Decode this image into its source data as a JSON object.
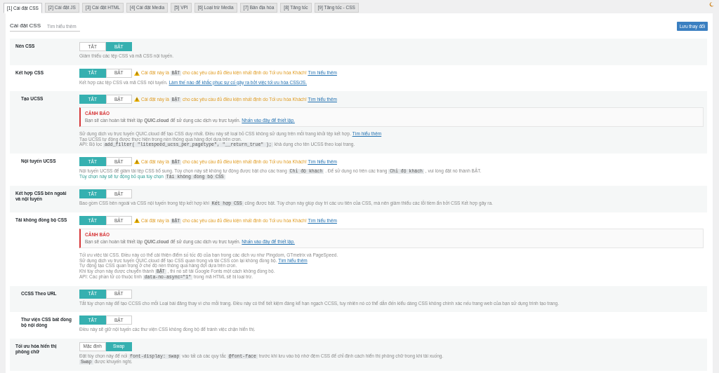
{
  "tabs": [
    {
      "label": "[1] Cài đặt CSS",
      "selected": true
    },
    {
      "label": "[2] Cài đặt JS",
      "selected": false
    },
    {
      "label": "[3] Cài đặt HTML",
      "selected": false
    },
    {
      "label": "[4] Cài đặt Media",
      "selected": false
    },
    {
      "label": "[5] VPI",
      "selected": false
    },
    {
      "label": "[6] Loại trừ Media",
      "selected": false
    },
    {
      "label": "[7] Bản địa hóa",
      "selected": false
    },
    {
      "label": "[8] Tăng tốc",
      "selected": false
    },
    {
      "label": "[9] Tăng tốc - CSS",
      "selected": false
    }
  ],
  "header": {
    "title": "Cài đặt CSS",
    "link": "Tìm hiểu thêm",
    "save_button": "Lưu thay đổi"
  },
  "settings": [
    {
      "label": "Nén CSS",
      "toggle": [
        {
          "label": "TẮT",
          "selected": false
        },
        {
          "label": "BẬT",
          "selected": true
        }
      ],
      "description": [
        {
          "kind": "plain",
          "parts": [
            {
              "kind": "text",
              "text": "Giảm thiểu các tệp CSS và mã CSS nội tuyến."
            }
          ]
        }
      ]
    },
    {
      "label": "Kết hợp CSS",
      "toggle": [
        {
          "label": "TẮT",
          "selected": true
        },
        {
          "label": "BẬT",
          "selected": false
        }
      ],
      "warning": {
        "parts": [
          {
            "kind": "text",
            "text": "Cài đặt này là"
          },
          {
            "kind": "code",
            "text": "BẬT"
          },
          {
            "kind": "text",
            "text": "cho các yêu cầu đủ điều kiện nhất định do Tối ưu hóa Khách!"
          },
          {
            "kind": "link",
            "text": "Tìm hiểu thêm"
          }
        ]
      },
      "description": [
        {
          "kind": "plain",
          "parts": [
            {
              "kind": "text",
              "text": "Kết hợp các tệp CSS và mã CSS nội tuyến."
            },
            {
              "kind": "link",
              "text": "Làm thế nào để khắc phục sự cố gây ra bởi việc tối ưu hóa CSS/JS."
            }
          ]
        }
      ],
      "children": [
        {
          "label": "Tạo UCSS",
          "toggle": [
            {
              "label": "TẮT",
              "selected": true
            },
            {
              "label": "BẬT",
              "selected": false
            }
          ],
          "warning": {
            "parts": [
              {
                "kind": "text",
                "text": "Cài đặt này là"
              },
              {
                "kind": "code",
                "text": "BẬT"
              },
              {
                "kind": "text",
                "text": "cho các yêu cầu đủ điều kiện nhất định do Tối ưu hóa Khách!"
              },
              {
                "kind": "link",
                "text": "Tìm hiểu thêm"
              }
            ]
          },
          "notice": {
            "title": "CẢNH BÁO",
            "parts": [
              {
                "kind": "text",
                "text": "Bạn sẽ cần hoàn tất thiết lập **QUIC.cloud** để sử dụng các dịch vụ trực tuyến."
              },
              {
                "kind": "link",
                "text": "Nhấn vào đây để thiết lập."
              }
            ]
          },
          "description": [
            {
              "kind": "plain",
              "parts": [
                {
                  "kind": "text",
                  "text": "Sử dụng dịch vụ trực tuyến QUIC.cloud để tạo CSS duy nhất. Điều này sẽ loại bỏ CSS không sử dụng trên mỗi trang khỏi tệp kết hợp."
                },
                {
                  "kind": "link",
                  "text": "Tìm hiểu thêm"
                }
              ]
            },
            {
              "kind": "plain",
              "parts": [
                {
                  "kind": "text",
                  "text": "Tạo UCSS tự động được thực hiện trong nền thông qua hàng đợi dựa trên cron."
                }
              ]
            },
            {
              "kind": "plain",
              "parts": [
                {
                  "kind": "text",
                  "text": "API: Bộ lọc"
                },
                {
                  "kind": "code",
                  "text": "add_filter( \"litespeed_ucss_per_pagetype\", \"__return_true\" );"
                },
                {
                  "kind": "text",
                  "text": "khả dụng cho tên UCSS theo loại trang."
                }
              ]
            }
          ]
        },
        {
          "label": "Nội tuyến UCSS",
          "toggle": [
            {
              "label": "TẮT",
              "selected": true
            },
            {
              "label": "BẬT",
              "selected": false
            }
          ],
          "warning": {
            "parts": [
              {
                "kind": "text",
                "text": "Cài đặt này là"
              },
              {
                "kind": "code",
                "text": "BẬT"
              },
              {
                "kind": "text",
                "text": "cho các yêu cầu đủ điều kiện nhất định do Tối ưu hóa Khách!"
              },
              {
                "kind": "link",
                "text": "Tìm hiểu thêm"
              }
            ]
          },
          "description": [
            {
              "kind": "plain",
              "parts": [
                {
                  "kind": "text",
                  "text": "Nội tuyến UCSS để giảm tải tệp CSS bổ sung. Tùy chọn này sẽ không tự động được bật cho các trang"
                },
                {
                  "kind": "code",
                  "text": "Chỉ độ khách"
                },
                {
                  "kind": "text",
                  "text": ". Để sử dụng nó trên các trang"
                },
                {
                  "kind": "code",
                  "text": "Chỉ độ khách"
                },
                {
                  "kind": "text",
                  "text": ", vui lòng đặt nó thành BẬT."
                }
              ]
            },
            {
              "kind": "note",
              "parts": [
                {
                  "kind": "text",
                  "text": "Tùy chọn này sẽ tự động bỏ qua tùy chọn"
                },
                {
                  "kind": "code",
                  "text": "Tải không đồng bộ CSS"
                }
              ]
            }
          ]
        }
      ]
    },
    {
      "label": "Kết hợp CSS bên ngoài và nội tuyến",
      "toggle": [
        {
          "label": "TẮT",
          "selected": true
        },
        {
          "label": "BẬT",
          "selected": false
        }
      ],
      "description": [
        {
          "kind": "plain",
          "parts": [
            {
              "kind": "text",
              "text": "Bao gồm CSS bên ngoài và CSS nội tuyến trong tệp kết hợp khi"
            },
            {
              "kind": "code",
              "text": "Kết hợp CSS"
            },
            {
              "kind": "text",
              "text": "cũng được bật. Tùy chọn này giúp duy trì các ưu tiên của CSS, mà nên giảm thiểu các lỗi tiềm ẩn bởi CSS Kết hợp gây ra."
            }
          ]
        }
      ]
    },
    {
      "label": "Tải không đồng bộ CSS",
      "toggle": [
        {
          "label": "TẮT",
          "selected": true
        },
        {
          "label": "BẬT",
          "selected": false
        }
      ],
      "warning": {
        "parts": [
          {
            "kind": "text",
            "text": "Cài đặt này là"
          },
          {
            "kind": "code",
            "text": "BẬT"
          },
          {
            "kind": "text",
            "text": "cho các yêu cầu đủ điều kiện nhất định do Tối ưu hóa Khách!"
          },
          {
            "kind": "link",
            "text": "Tìm hiểu thêm"
          }
        ]
      },
      "notice": {
        "title": "CẢNH BÁO",
        "parts": [
          {
            "kind": "text",
            "text": "Bạn sẽ cần hoàn tất thiết lập **QUIC.cloud** để sử dụng các dịch vụ trực tuyến."
          },
          {
            "kind": "link",
            "text": "Nhấn vào đây để thiết lập."
          }
        ]
      },
      "description": [
        {
          "kind": "plain",
          "parts": [
            {
              "kind": "text",
              "text": "Tối ưu việc tải CSS. Điều này có thể cải thiện điểm số tốc độ của bạn trong các dịch vụ như Pingdom, GTmetrix và PageSpeed."
            }
          ]
        },
        {
          "kind": "plain",
          "parts": [
            {
              "kind": "text",
              "text": "Sử dụng dịch vụ trực tuyến QUIC.cloud để tạo CSS quan trọng và tải CSS còn lại không đồng bộ."
            },
            {
              "kind": "link",
              "text": "Tìm hiểu thêm"
            }
          ]
        },
        {
          "kind": "plain",
          "parts": [
            {
              "kind": "text",
              "text": "Tự động tạo CSS quan trọng ở chế độ nền thông qua hàng đợi dựa trên cron."
            }
          ]
        },
        {
          "kind": "plain",
          "parts": [
            {
              "kind": "text",
              "text": "Khi tùy chọn này được chuyển thành"
            },
            {
              "kind": "code",
              "text": "BẬT"
            },
            {
              "kind": "text",
              "text": ", thì nó sẽ tải Google Fonts một cách không đồng bộ."
            }
          ]
        },
        {
          "kind": "plain",
          "parts": [
            {
              "kind": "text",
              "text": "API: Các phần tử có thuộc tính"
            },
            {
              "kind": "code",
              "text": "data-no-async=\"1\""
            },
            {
              "kind": "text",
              "text": "trong mã HTML sẽ bị loại trừ."
            }
          ]
        }
      ],
      "children": [
        {
          "label": "CCSS Theo URL",
          "toggle": [
            {
              "label": "TẮT",
              "selected": true
            },
            {
              "label": "BẬT",
              "selected": false
            }
          ],
          "description": [
            {
              "kind": "plain",
              "parts": [
                {
                  "kind": "text",
                  "text": "Tắt tùy chọn này để tạo CCSS cho mỗi Loại bài đăng thay vì cho mỗi trang. Điều này có thể tiết kiệm đáng kể hạn ngạch CCSS, tuy nhiên nó có thể dẫn đến kiểu dáng CSS không chính xác nếu trang web của bạn sử dụng trình tạo trang."
                }
              ]
            }
          ]
        },
        {
          "label": "Thư viện CSS bất đồng bộ nội dòng",
          "toggle": [
            {
              "label": "TẮT",
              "selected": true
            },
            {
              "label": "BẬT",
              "selected": false
            }
          ],
          "description": [
            {
              "kind": "plain",
              "parts": [
                {
                  "kind": "text",
                  "text": "Điều này sẽ giữ nội tuyến các thư viện CSS không đồng bộ để tránh việc chặn hiển thị."
                }
              ]
            }
          ]
        }
      ]
    },
    {
      "label": "Tối ưu hóa hiển thị phông chữ",
      "toggle": [
        {
          "label": "Mặc định",
          "selected": false
        },
        {
          "label": "Swap",
          "selected": true
        }
      ],
      "description": [
        {
          "kind": "plain",
          "parts": [
            {
              "kind": "text",
              "text": "Đặt tùy chọn này để nối"
            },
            {
              "kind": "code",
              "text": "font-display: swap"
            },
            {
              "kind": "text",
              "text": "vào tất cả các quy tắc"
            },
            {
              "kind": "code",
              "text": "@font-face"
            },
            {
              "kind": "text",
              "text": "trước khi lưu vào bộ nhớ đệm CSS để chỉ định cách hiển thị phông chữ trong khi tải xuống."
            }
          ]
        },
        {
          "kind": "plain",
          "parts": [
            {
              "kind": "code",
              "text": "Swap"
            },
            {
              "kind": "text",
              "text": "được khuyến nghị."
            }
          ]
        }
      ]
    }
  ]
}
